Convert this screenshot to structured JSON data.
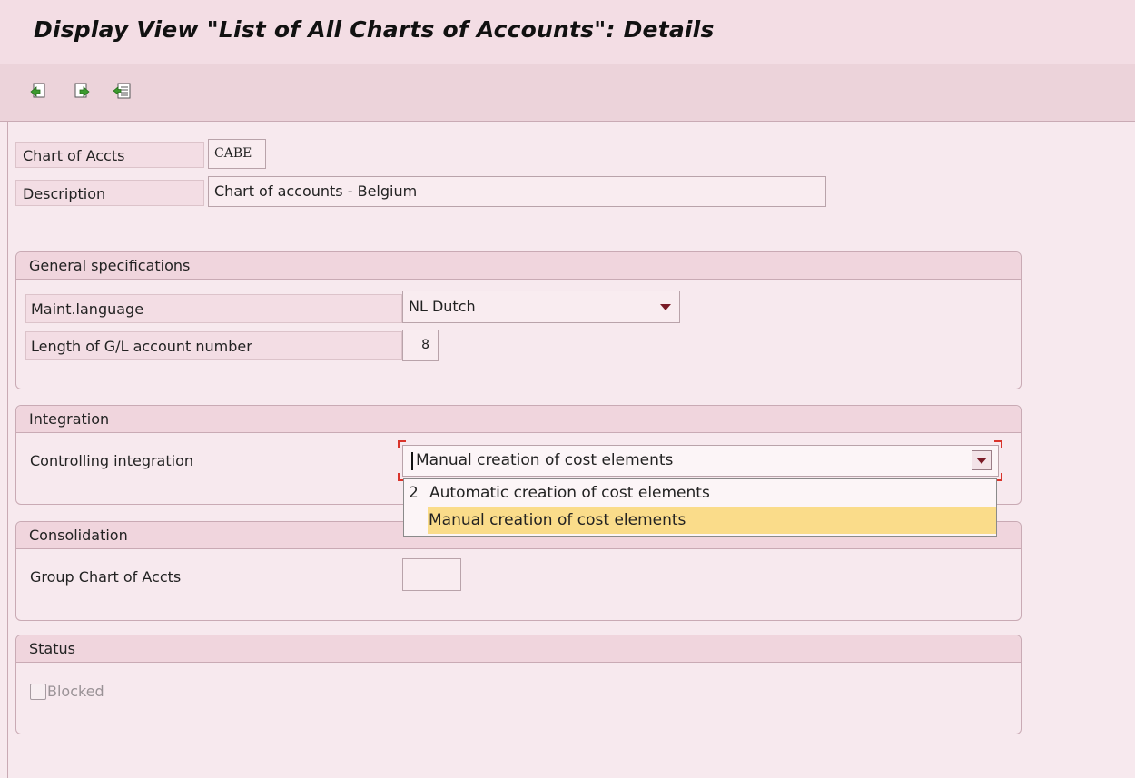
{
  "window": {
    "title": "Display View \"List of All Charts of Accounts\": Details"
  },
  "toolbar": {
    "icons": [
      "previous-entry-icon",
      "next-entry-icon",
      "other-entry-icon"
    ]
  },
  "header_fields": {
    "chart_of_accts_label": "Chart of Accts",
    "chart_of_accts_value": "CABE",
    "description_label": "Description",
    "description_value": "Chart of accounts - Belgium"
  },
  "general_specifications": {
    "title": "General specifications",
    "maint_language_label": "Maint.language",
    "maint_language_value": "NL Dutch",
    "gl_length_label": "Length of G/L account number",
    "gl_length_value": "8"
  },
  "integration": {
    "title": "Integration",
    "controlling_label": "Controlling integration",
    "controlling_value": "Manual creation of cost elements",
    "options": [
      {
        "key": "2",
        "text": "Automatic creation of cost elements",
        "selected": false
      },
      {
        "key": "",
        "text": "Manual creation of cost elements",
        "selected": true
      }
    ]
  },
  "consolidation": {
    "title": "Consolidation",
    "group_chart_label": "Group Chart of Accts",
    "group_chart_value": ""
  },
  "status": {
    "title": "Status",
    "blocked_label": "Blocked",
    "blocked_checked": false
  },
  "colors": {
    "background": "#f7e9ee",
    "selection": "#fadc8a",
    "dropdown_arrow": "#7a1a26",
    "focus_marker": "#d9342b"
  }
}
